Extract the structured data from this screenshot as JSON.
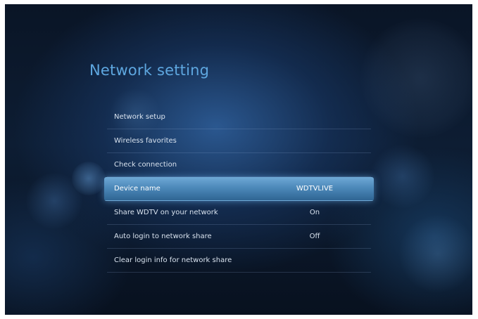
{
  "page": {
    "title": "Network setting"
  },
  "menu": {
    "items": [
      {
        "label": "Network setup",
        "value": ""
      },
      {
        "label": "Wireless favorites",
        "value": ""
      },
      {
        "label": "Check connection",
        "value": ""
      },
      {
        "label": "Device name",
        "value": "WDTVLIVE",
        "selected": true
      },
      {
        "label": "Share WDTV on your network",
        "value": "On"
      },
      {
        "label": "Auto login to network share",
        "value": "Off"
      },
      {
        "label": "Clear login info for network share",
        "value": ""
      }
    ]
  },
  "colors": {
    "title": "#5ea7e0",
    "highlight": "#4d89ba",
    "background": "#0d1d33"
  }
}
